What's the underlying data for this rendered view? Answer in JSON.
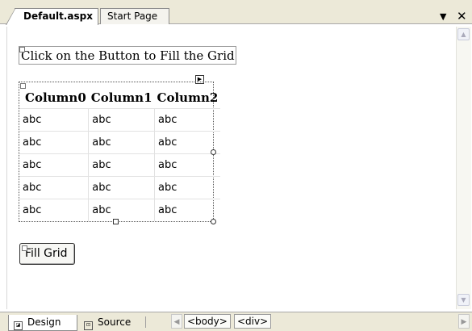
{
  "tabs": [
    {
      "label": "Default.aspx",
      "active": true
    },
    {
      "label": "Start Page",
      "active": false
    }
  ],
  "window_controls": {
    "dropdown_icon": "chevron-down-icon",
    "close_icon": "close-icon",
    "dropdown_glyph": "▼",
    "close_glyph": "✕"
  },
  "design": {
    "heading": "Click on the Button to Fill the Grid",
    "grid": {
      "columns": [
        "Column0",
        "Column1",
        "Column2"
      ],
      "rows": [
        [
          "abc",
          "abc",
          "abc"
        ],
        [
          "abc",
          "abc",
          "abc"
        ],
        [
          "abc",
          "abc",
          "abc"
        ],
        [
          "abc",
          "abc",
          "abc"
        ],
        [
          "abc",
          "abc",
          "abc"
        ]
      ]
    },
    "fill_button_label": "Fill Grid"
  },
  "bottom": {
    "views": [
      {
        "label": "Design",
        "icon": "design-view-icon",
        "active": true
      },
      {
        "label": "Source",
        "icon": "source-view-icon",
        "active": false
      }
    ],
    "tag_path": [
      "<body>",
      "<div>"
    ]
  },
  "colors": {
    "chrome": "#ece9d8",
    "border": "#8c8c8c",
    "surface": "#ffffff"
  }
}
